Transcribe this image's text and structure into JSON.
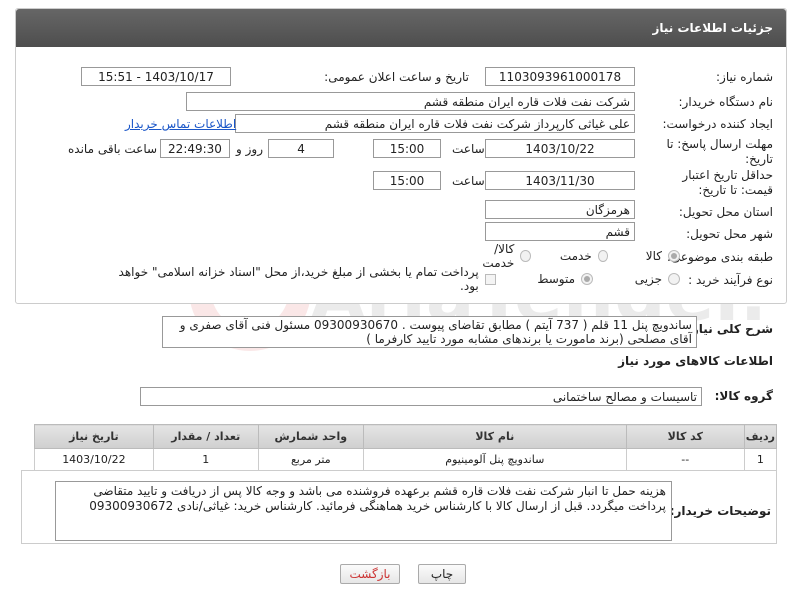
{
  "header": {
    "title": "جزئیات اطلاعات نیاز"
  },
  "form": {
    "need_number_label": "شماره نیاز:",
    "need_number": "1103093961000178",
    "announce_label": "تاریخ و ساعت اعلان عمومی:",
    "announce_value": "1403/10/17 - 15:51",
    "buyer_org_label": "نام دستگاه خریدار:",
    "buyer_org": "شرکت نفت فلات قاره ایران منطقه قشم",
    "creator_label": "ایجاد کننده درخواست:",
    "creator": "علی غیاثی کارپرداز شرکت نفت فلات قاره ایران منطقه قشم",
    "contact_link": "اطلاعات تماس خریدار",
    "deadline_label": "مهلت ارسال پاسخ: تا تاریخ:",
    "deadline_date": "1403/10/22",
    "time_label": "ساعت",
    "deadline_time": "15:00",
    "days_value": "4",
    "days_label": "روز و",
    "remaining_time": "22:49:30",
    "remaining_label": "ساعت باقی مانده",
    "validity_label": "حداقل تاریخ اعتبار قیمت: تا تاریخ:",
    "validity_date": "1403/11/30",
    "validity_time": "15:00",
    "province_label": "استان محل تحویل:",
    "province": "هرمزگان",
    "city_label": "شهر محل تحویل:",
    "city": "قشم",
    "category_label": "طبقه بندی موضوعی:",
    "category_options": [
      "کالا",
      "خدمت",
      "کالا/خدمت"
    ],
    "process_label": "نوع فرآیند خرید :",
    "process_options": [
      "جزیی",
      "متوسط"
    ],
    "payment_note": "پرداخت تمام یا بخشی از مبلغ خرید،از محل \"اسناد خزانه اسلامی\" خواهد بود."
  },
  "summary": {
    "label": "شرح کلی نیاز:",
    "text": "ساندویچ پنل 11 قلم ( 737 آیتم ) مطابق تقاضای پیوست . 09300930670 مسئول فنی آقای صفری و آقای مصلحی (برند مامورت یا برندهای مشابه مورد تایید کارفرما )"
  },
  "goods_info": {
    "title": "اطلاعات کالاهای مورد نیاز",
    "group_label": "گروه کالا:",
    "group_value": "تاسیسات و مصالح ساختمانی"
  },
  "table": {
    "headers": [
      "ردیف",
      "کد کالا",
      "نام کالا",
      "واحد شمارش",
      "تعداد / مقدار",
      "تاریخ نیاز"
    ],
    "rows": [
      [
        "1",
        "--",
        "ساندویچ پنل آلومینیوم",
        "متر مربع",
        "1",
        "1403/10/22"
      ]
    ]
  },
  "buyer_notes": {
    "label": "توضیحات خریدار:",
    "text": "هزینه حمل تا انبار شرکت نفت فلات قاره قشم برعهده فروشنده می باشد و وجه کالا پس از دریافت و تایید متقاضی پرداخت میگردد. قبل از ارسال کالا با کارشناس خرید هماهنگی فرمائید. کارشناس خرید: غیاثی/نادی 09300930672"
  },
  "buttons": {
    "print": "چاپ",
    "back": "بازگشت"
  },
  "watermark": "AriaTender.net"
}
